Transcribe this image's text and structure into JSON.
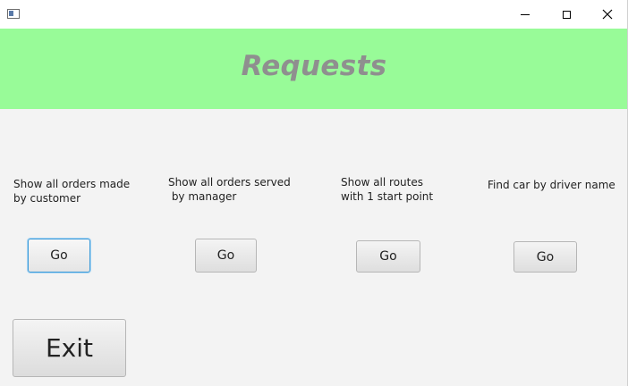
{
  "window": {
    "minimize_glyph": "",
    "close_glyph": "✕"
  },
  "header": {
    "title": "Requests",
    "background": "#98fb98",
    "title_color": "#8f8f8f"
  },
  "requests": [
    {
      "label": "Show all orders made\nby customer",
      "button_label": "Go"
    },
    {
      "label": "Show all orders served\n by manager",
      "button_label": "Go"
    },
    {
      "label": "Show all routes\nwith 1 start point",
      "button_label": "Go"
    },
    {
      "label": "Find car by driver name",
      "button_label": "Go"
    }
  ],
  "footer": {
    "exit_label": "Exit"
  },
  "colors": {
    "background": "#f3f3f3",
    "focus_border": "#3a9ad9"
  }
}
